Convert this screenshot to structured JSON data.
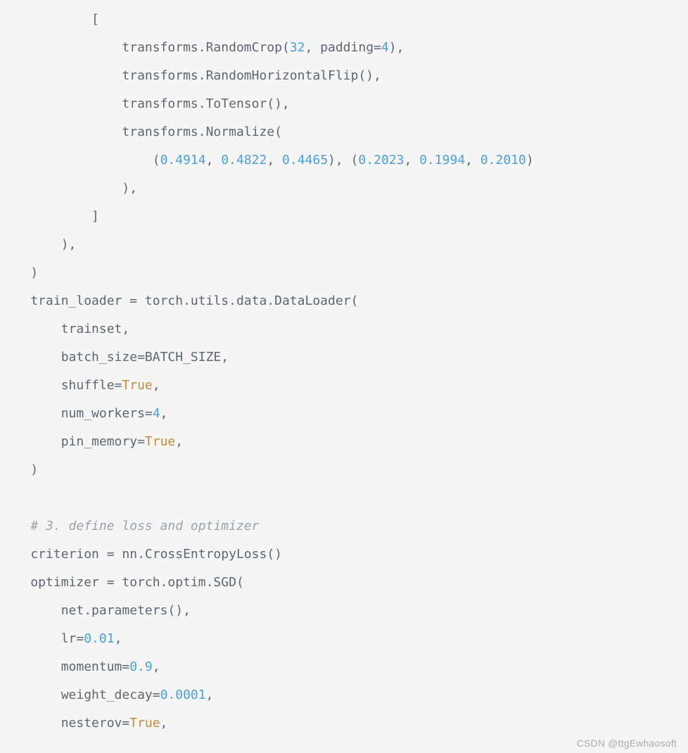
{
  "code": {
    "tokens": [
      {
        "t": "text",
        "v": "            [\n"
      },
      {
        "t": "text",
        "v": "                transforms.RandomCrop("
      },
      {
        "t": "num",
        "v": "32"
      },
      {
        "t": "text",
        "v": ", padding="
      },
      {
        "t": "num",
        "v": "4"
      },
      {
        "t": "text",
        "v": "),\n"
      },
      {
        "t": "text",
        "v": "                transforms.RandomHorizontalFlip(),\n"
      },
      {
        "t": "text",
        "v": "                transforms.ToTensor(),\n"
      },
      {
        "t": "text",
        "v": "                transforms.Normalize(\n"
      },
      {
        "t": "text",
        "v": "                    ("
      },
      {
        "t": "num",
        "v": "0.4914"
      },
      {
        "t": "text",
        "v": ", "
      },
      {
        "t": "num",
        "v": "0.4822"
      },
      {
        "t": "text",
        "v": ", "
      },
      {
        "t": "num",
        "v": "0.4465"
      },
      {
        "t": "text",
        "v": "), ("
      },
      {
        "t": "num",
        "v": "0.2023"
      },
      {
        "t": "text",
        "v": ", "
      },
      {
        "t": "num",
        "v": "0.1994"
      },
      {
        "t": "text",
        "v": ", "
      },
      {
        "t": "num",
        "v": "0.2010"
      },
      {
        "t": "text",
        "v": ")\n"
      },
      {
        "t": "text",
        "v": "                ),\n"
      },
      {
        "t": "text",
        "v": "            ]\n"
      },
      {
        "t": "text",
        "v": "        ),\n"
      },
      {
        "t": "text",
        "v": "    )\n"
      },
      {
        "t": "text",
        "v": "    train_loader = torch.utils.data.DataLoader(\n"
      },
      {
        "t": "text",
        "v": "        trainset,\n"
      },
      {
        "t": "text",
        "v": "        batch_size=BATCH_SIZE,\n"
      },
      {
        "t": "text",
        "v": "        shuffle="
      },
      {
        "t": "kw",
        "v": "True"
      },
      {
        "t": "text",
        "v": ",\n"
      },
      {
        "t": "text",
        "v": "        num_workers="
      },
      {
        "t": "num",
        "v": "4"
      },
      {
        "t": "text",
        "v": ",\n"
      },
      {
        "t": "text",
        "v": "        pin_memory="
      },
      {
        "t": "kw",
        "v": "True"
      },
      {
        "t": "text",
        "v": ",\n"
      },
      {
        "t": "text",
        "v": "    )\n"
      },
      {
        "t": "text",
        "v": "\n"
      },
      {
        "t": "text",
        "v": "    "
      },
      {
        "t": "com",
        "v": "# 3. define loss and optimizer"
      },
      {
        "t": "text",
        "v": "\n"
      },
      {
        "t": "text",
        "v": "    criterion = nn.CrossEntropyLoss()\n"
      },
      {
        "t": "text",
        "v": "    optimizer = torch.optim.SGD(\n"
      },
      {
        "t": "text",
        "v": "        net.parameters(),\n"
      },
      {
        "t": "text",
        "v": "        lr="
      },
      {
        "t": "num",
        "v": "0.01"
      },
      {
        "t": "text",
        "v": ",\n"
      },
      {
        "t": "text",
        "v": "        momentum="
      },
      {
        "t": "num",
        "v": "0.9"
      },
      {
        "t": "text",
        "v": ",\n"
      },
      {
        "t": "text",
        "v": "        weight_decay="
      },
      {
        "t": "num",
        "v": "0.0001"
      },
      {
        "t": "text",
        "v": ",\n"
      },
      {
        "t": "text",
        "v": "        nesterov="
      },
      {
        "t": "kw",
        "v": "True"
      },
      {
        "t": "text",
        "v": ","
      }
    ]
  },
  "watermark": "CSDN @ttgEwhaosoft"
}
